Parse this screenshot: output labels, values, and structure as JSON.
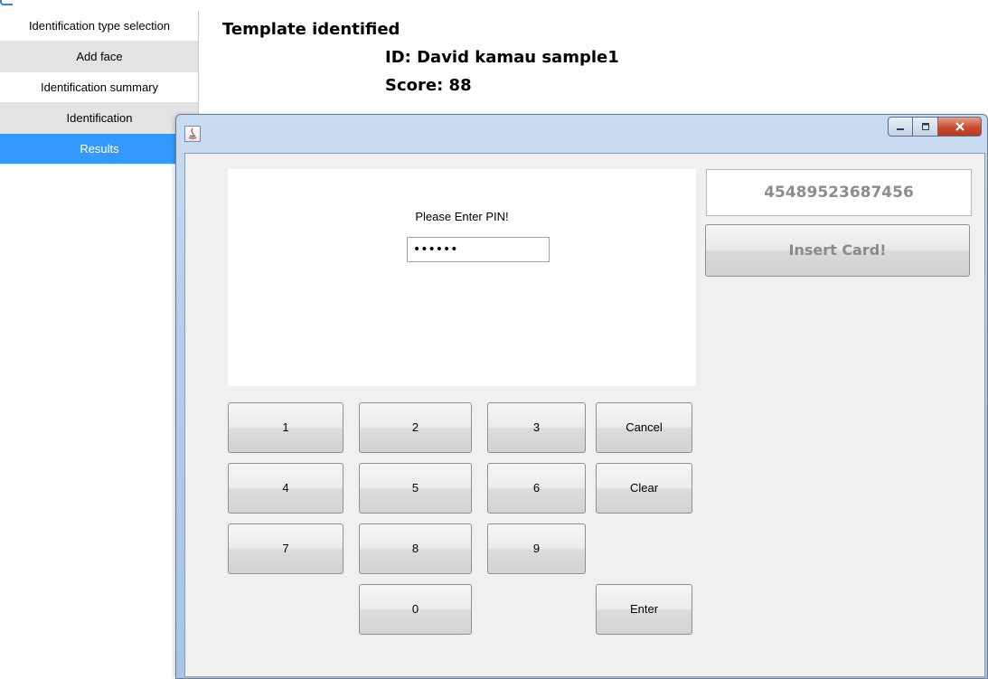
{
  "steps": [
    {
      "label": "Identification type selection"
    },
    {
      "label": "Add face"
    },
    {
      "label": "Identification summary"
    },
    {
      "label": "Identification"
    },
    {
      "label": "Results"
    }
  ],
  "result": {
    "heading": "Template identified",
    "id_line": "ID: David kamau sample1",
    "score_line": "Score: 88"
  },
  "window": {
    "app_icon": "java-icon",
    "buttons": {
      "minimize": "minimize-icon",
      "maximize": "maximize-icon",
      "close": "close-icon"
    }
  },
  "pin": {
    "prompt": "Please Enter PIN!",
    "value": "••••••"
  },
  "card": {
    "number": "45489523687456",
    "insert_label": "Insert Card!"
  },
  "keypad": {
    "k1": "1",
    "k2": "2",
    "k3": "3",
    "k4": "4",
    "k5": "5",
    "k6": "6",
    "k7": "7",
    "k8": "8",
    "k9": "9",
    "k0": "0",
    "cancel": "Cancel",
    "clear": "Clear",
    "enter": "Enter"
  },
  "colors": {
    "active_step": "#3399ff",
    "inactive_step": "#e3e3e3"
  }
}
